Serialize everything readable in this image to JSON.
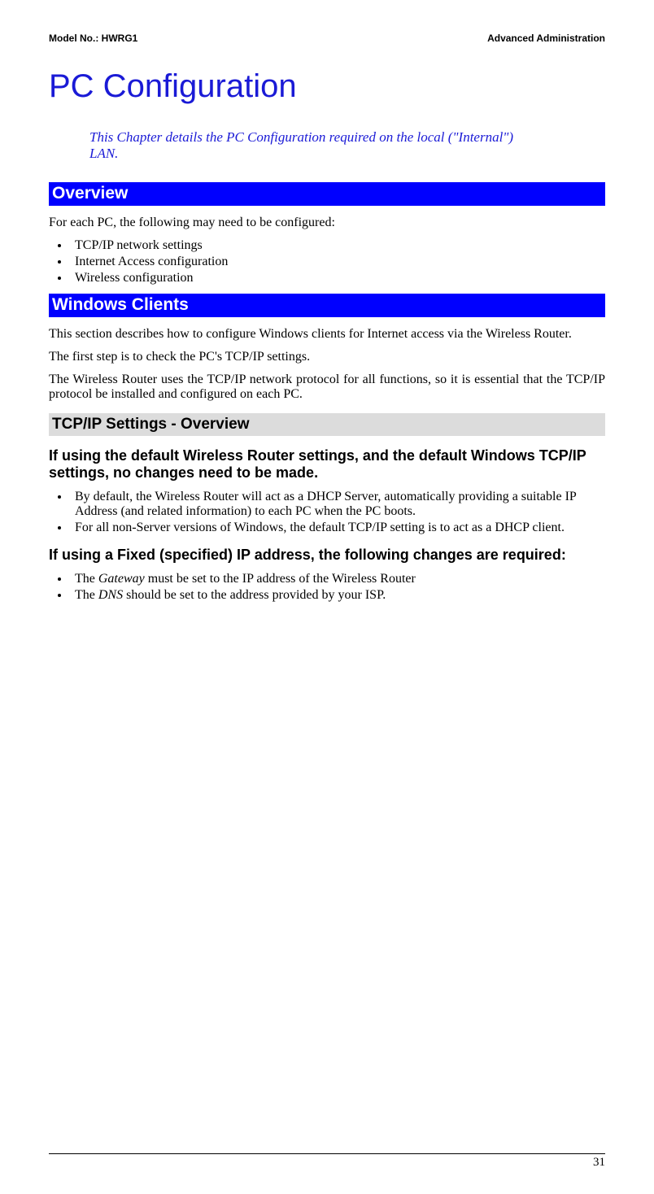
{
  "header": {
    "model": "Model No.: HWRG1",
    "section": "Advanced Administration"
  },
  "chapter": {
    "title": "PC Configuration",
    "subtitle": "This Chapter details the PC Configuration required on the local (\"Internal\") LAN."
  },
  "overview": {
    "heading": "Overview",
    "intro": "For each PC, the following may need to be configured:",
    "items": [
      "TCP/IP network settings",
      "Internet Access configuration",
      "Wireless configuration"
    ]
  },
  "windows": {
    "heading": "Windows Clients",
    "para1": "This section describes how to configure Windows clients for Internet access via the Wireless Router.",
    "para2": "The first step is to check the PC's TCP/IP settings.",
    "para3": "The Wireless Router uses the TCP/IP network protocol for all functions, so it is essential that the TCP/IP protocol be installed and configured on each PC."
  },
  "tcpip": {
    "heading": "TCP/IP Settings - Overview",
    "default_heading": "If using the default Wireless Router settings, and the default Windows TCP/IP settings, no changes need to be made.",
    "default_items": [
      "By default, the Wireless Router will act as a DHCP Server, automatically providing a suitable IP Address (and related information) to each PC when the PC boots.",
      "For all non-Server versions of Windows, the default TCP/IP setting is to act as a DHCP client."
    ],
    "fixed_heading": "If using a Fixed (specified) IP address, the following changes are required:",
    "fixed_items": [
      {
        "prefix": "The ",
        "em": "Gateway",
        "suffix": " must be set to the IP address of the Wireless Router"
      },
      {
        "prefix": "The ",
        "em": "DNS",
        "suffix": " should be set to the address provided by your ISP."
      }
    ]
  },
  "footer": {
    "page": "31"
  }
}
